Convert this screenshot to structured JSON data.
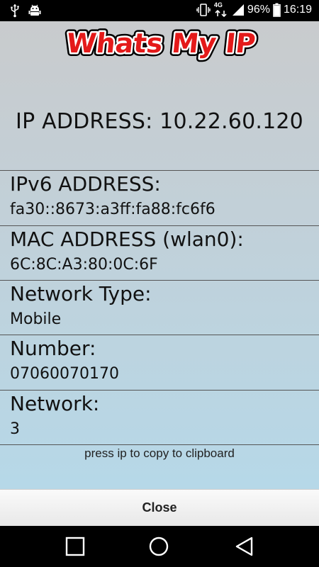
{
  "status_bar": {
    "network_badge": "4G",
    "battery_percent": "96%",
    "time": "16:19"
  },
  "app": {
    "logo_text": "Whats My IP"
  },
  "ip": {
    "label": "IP ADDRESS:",
    "value": "10.22.60.120"
  },
  "rows": [
    {
      "label": "IPv6 ADDRESS:",
      "value": "fa30::8673:a3ff:fa88:fc6f6"
    },
    {
      "label": "MAC ADDRESS (wlan0):",
      "value": "6C:8C:A3:80:0C:6F"
    },
    {
      "label": "Network Type:",
      "value": "Mobile"
    },
    {
      "label": "Number:",
      "value": "07060070170"
    },
    {
      "label": "Network:",
      "value": "3"
    }
  ],
  "hint": "press ip to copy to clipboard",
  "close_label": "Close",
  "colors": {
    "logo_fill": "#e41a1a",
    "background_top": "#c9cbcd",
    "background_bottom": "#b6d8e8"
  },
  "nav": {
    "icons": [
      "overview-icon",
      "home-icon",
      "back-icon"
    ]
  }
}
